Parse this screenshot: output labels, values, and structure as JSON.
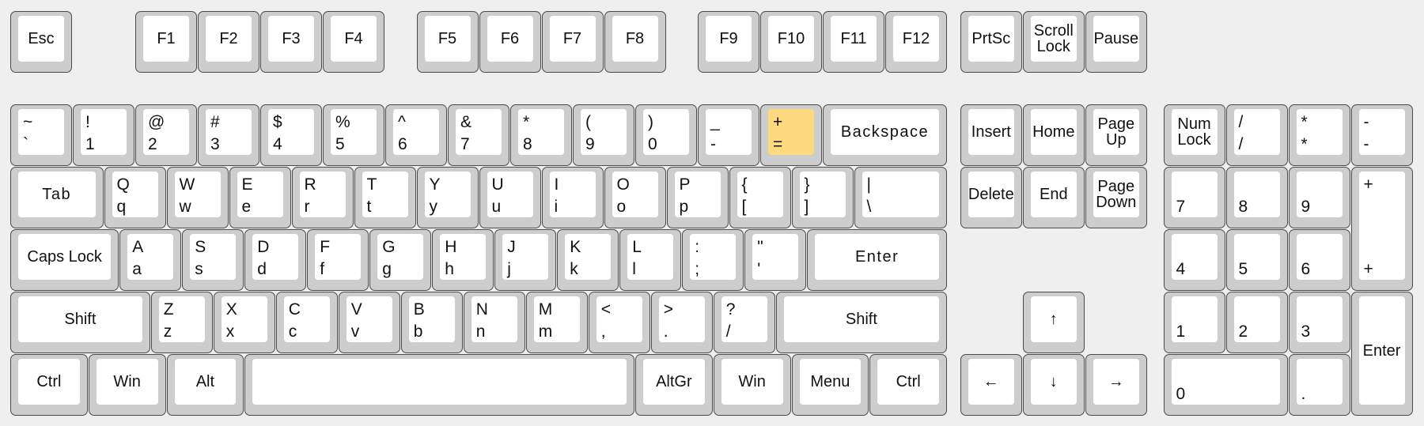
{
  "highlight_color": "#ffd97f",
  "highlighted_key": "+ =",
  "keys": [
    {
      "label": "Esc"
    },
    {
      "label": "F1"
    },
    {
      "label": "F2"
    },
    {
      "label": "F3"
    },
    {
      "label": "F4"
    },
    {
      "label": "F5"
    },
    {
      "label": "F6"
    },
    {
      "label": "F7"
    },
    {
      "label": "F8"
    },
    {
      "label": "F9"
    },
    {
      "label": "F10"
    },
    {
      "label": "F11"
    },
    {
      "label": "F12"
    },
    {
      "label": "PrtSc"
    },
    {
      "label": "Scroll\nLock"
    },
    {
      "label": "Pause"
    },
    {
      "top": "~",
      "bottom": "`"
    },
    {
      "top": "!",
      "bottom": "1"
    },
    {
      "top": "@",
      "bottom": "2"
    },
    {
      "top": "#",
      "bottom": "3"
    },
    {
      "top": "$",
      "bottom": "4"
    },
    {
      "top": "%",
      "bottom": "5"
    },
    {
      "top": "^",
      "bottom": "6"
    },
    {
      "top": "&",
      "bottom": "7"
    },
    {
      "top": "*",
      "bottom": "8"
    },
    {
      "top": "(",
      "bottom": "9"
    },
    {
      "top": ")",
      "bottom": "0"
    },
    {
      "top": "_",
      "bottom": "-"
    },
    {
      "top": "+",
      "bottom": "="
    },
    {
      "label": "Backspace"
    },
    {
      "label": "Insert"
    },
    {
      "label": "Home"
    },
    {
      "label": "Page\nUp"
    },
    {
      "label": "Num\nLock"
    },
    {
      "top": "/",
      "bottom": "/"
    },
    {
      "top": "*",
      "bottom": "*"
    },
    {
      "top": "-",
      "bottom": "-"
    },
    {
      "label": "Tab"
    },
    {
      "top": "Q",
      "bottom": "q"
    },
    {
      "top": "W",
      "bottom": "w"
    },
    {
      "top": "E",
      "bottom": "e"
    },
    {
      "top": "R",
      "bottom": "r"
    },
    {
      "top": "T",
      "bottom": "t"
    },
    {
      "top": "Y",
      "bottom": "y"
    },
    {
      "top": "U",
      "bottom": "u"
    },
    {
      "top": "I",
      "bottom": "i"
    },
    {
      "top": "O",
      "bottom": "o"
    },
    {
      "top": "P",
      "bottom": "p"
    },
    {
      "top": "{",
      "bottom": "["
    },
    {
      "top": "}",
      "bottom": "]"
    },
    {
      "top": "|",
      "bottom": "\\"
    },
    {
      "label": "Delete"
    },
    {
      "label": "End"
    },
    {
      "label": "Page\nDown"
    },
    {
      "label": "7"
    },
    {
      "label": "8"
    },
    {
      "label": "9"
    },
    {
      "top": "+",
      "bottom": "+"
    },
    {
      "label": "Caps Lock"
    },
    {
      "top": "A",
      "bottom": "a"
    },
    {
      "top": "S",
      "bottom": "s"
    },
    {
      "top": "D",
      "bottom": "d"
    },
    {
      "top": "F",
      "bottom": "f"
    },
    {
      "top": "G",
      "bottom": "g"
    },
    {
      "top": "H",
      "bottom": "h"
    },
    {
      "top": "J",
      "bottom": "j"
    },
    {
      "top": "K",
      "bottom": "k"
    },
    {
      "top": "L",
      "bottom": "l"
    },
    {
      "top": ":",
      "bottom": ";"
    },
    {
      "top": "\"",
      "bottom": "'"
    },
    {
      "label": "Enter"
    },
    {
      "label": "4"
    },
    {
      "label": "5"
    },
    {
      "label": "6"
    },
    {
      "label": "Shift"
    },
    {
      "top": "Z",
      "bottom": "z"
    },
    {
      "top": "X",
      "bottom": "x"
    },
    {
      "top": "C",
      "bottom": "c"
    },
    {
      "top": "V",
      "bottom": "v"
    },
    {
      "top": "B",
      "bottom": "b"
    },
    {
      "top": "N",
      "bottom": "n"
    },
    {
      "top": "M",
      "bottom": "m"
    },
    {
      "top": "<",
      "bottom": ","
    },
    {
      "top": ">",
      "bottom": "."
    },
    {
      "top": "?",
      "bottom": "/"
    },
    {
      "label": "Shift"
    },
    {
      "label": "↑"
    },
    {
      "label": "1"
    },
    {
      "label": "2"
    },
    {
      "label": "3"
    },
    {
      "label": "Enter"
    },
    {
      "label": "Ctrl"
    },
    {
      "label": "Win"
    },
    {
      "label": "Alt"
    },
    {
      "label": ""
    },
    {
      "label": "AltGr"
    },
    {
      "label": "Win"
    },
    {
      "label": "Menu"
    },
    {
      "label": "Ctrl"
    },
    {
      "label": "←"
    },
    {
      "label": "↓"
    },
    {
      "label": "→"
    },
    {
      "label": "0"
    },
    {
      "label": "."
    }
  ]
}
